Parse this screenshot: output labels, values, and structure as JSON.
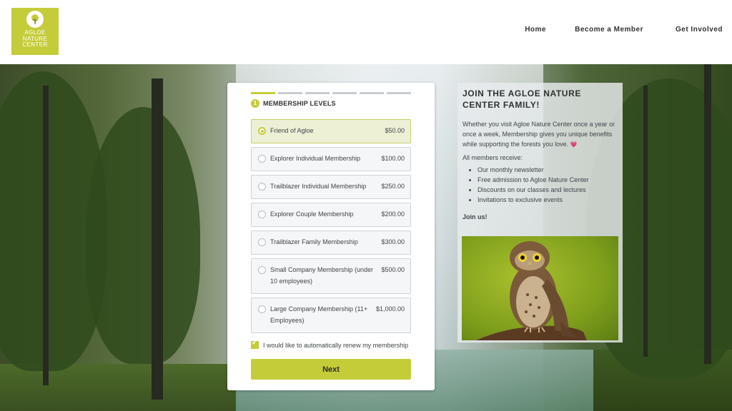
{
  "logo": {
    "text_line1": "AGLOE",
    "text_line2": "NATURE",
    "text_line3": "CENTER"
  },
  "nav": {
    "home": "Home",
    "become_member": "Become a Member",
    "get_involved": "Get Involved"
  },
  "form": {
    "step_number": "1",
    "step_title": "MEMBERSHIP LEVELS",
    "progress_total_steps": 6,
    "progress_current_step": 1,
    "options": [
      {
        "label": "Friend of Agloe",
        "price": "$50.00",
        "selected": true
      },
      {
        "label": "Explorer Individual Membership",
        "price": "$100.00",
        "selected": false
      },
      {
        "label": "Trailblazer Individual Membership",
        "price": "$250.00",
        "selected": false
      },
      {
        "label": "Explorer Couple Membership",
        "price": "$200.00",
        "selected": false
      },
      {
        "label": "Trailblazer Family Membership",
        "price": "$300.00",
        "selected": false
      },
      {
        "label": "Small Company Membership (under 10 employees)",
        "price": "$500.00",
        "selected": false
      },
      {
        "label": "Large Company Membership (11+ Employees)",
        "price": "$1,000.00",
        "selected": false
      }
    ],
    "auto_renew_label": "I would like to automatically renew my membership",
    "auto_renew_checked": true,
    "next_label": "Next"
  },
  "info": {
    "title_line1": "JOIN THE AGLOE NATURE",
    "title_line2": "CENTER FAMILY!",
    "intro": "Whether you visit Agloe Nature Center once a year or once a week, Membership gives you unique benefits while supporting the forests you love.",
    "heart_emoji": "💗",
    "members_receive": "All members receive:",
    "benefits": [
      "Our monthly newsletter",
      "Free admission to Agloe Nature Center",
      "Discounts on our classes and lectures",
      "Invitations to exclusive events"
    ],
    "join_us": "Join us!"
  },
  "colors": {
    "accent": "#c4cc3a",
    "text": "#3f4549",
    "header_bg": "#ffffff"
  }
}
